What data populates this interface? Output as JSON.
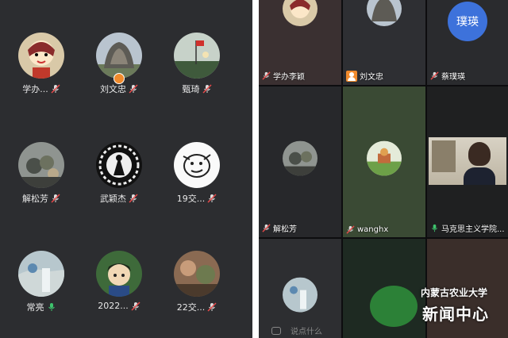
{
  "left_panel": {
    "members": [
      {
        "name": "学办...",
        "mic": "muted",
        "avatar": "cartoon-girl-icon"
      },
      {
        "name": "刘文忠",
        "mic": "muted",
        "avatar": "tree-photo-icon",
        "host": true
      },
      {
        "name": "甄琦",
        "mic": "muted",
        "avatar": "flag-sunset-icon"
      },
      {
        "name": "解松芳",
        "mic": "muted",
        "avatar": "flowers-photo-icon"
      },
      {
        "name": "武颖杰",
        "mic": "muted",
        "avatar": "papercut-icon"
      },
      {
        "name": "19交...",
        "mic": "muted",
        "avatar": "sketch-cartoon-icon"
      },
      {
        "name": "常亮",
        "mic": "on",
        "avatar": "waterfall-photo-icon"
      },
      {
        "name": "2022...",
        "mic": "muted",
        "avatar": "anime-character-icon"
      },
      {
        "name": "22交...",
        "mic": "muted",
        "avatar": "garden-photo-icon"
      }
    ]
  },
  "right_panel": {
    "tiles": [
      {
        "name": "学办李颖",
        "icon": "mic-muted-icon"
      },
      {
        "name": "刘文忠",
        "icon": "person-badge-icon"
      },
      {
        "name": "蔡璞瑛",
        "icon": "mic-muted-icon",
        "avatar_text": "璞瑛"
      },
      {
        "name": "解松芳",
        "icon": "mic-muted-icon"
      },
      {
        "name": "wanghx",
        "icon": "mic-muted-icon"
      },
      {
        "name": "马克思主义学院...",
        "icon": "mic-on-icon"
      },
      {
        "name": "",
        "icon": ""
      },
      {
        "name": "",
        "icon": ""
      },
      {
        "name": "",
        "icon": ""
      }
    ],
    "speak_hint": "说点什么",
    "watermark": {
      "line1": "内蒙古农业大学",
      "line2": "新闻中心"
    }
  },
  "colors": {
    "muted_red": "#e84a4a",
    "mic_green": "#3ec46d",
    "accent_blue": "#3d72db",
    "host_orange": "#f08a2c"
  }
}
